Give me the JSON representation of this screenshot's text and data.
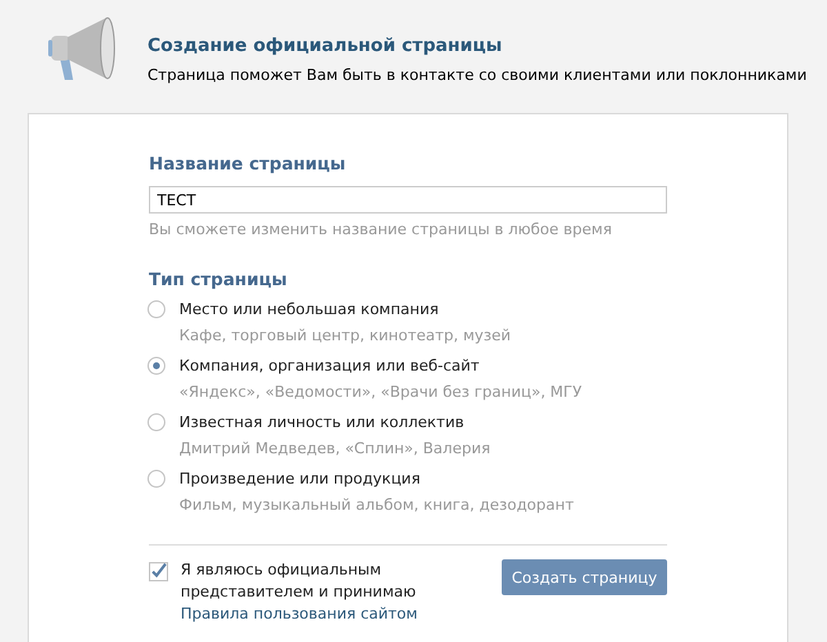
{
  "header": {
    "title": "Создание официальной страницы",
    "subtitle": "Страница поможет Вам быть в контакте со своими клиентами или поклонниками"
  },
  "name_section": {
    "heading": "Название страницы",
    "value": "ТЕСТ",
    "hint": "Вы сможете изменить название страницы в любое время"
  },
  "type_section": {
    "heading": "Тип страницы",
    "options": [
      {
        "label": "Место или небольшая компания",
        "description": "Кафе, торговый центр, кинотеатр, музей",
        "selected": false
      },
      {
        "label": "Компания, организация или веб-сайт",
        "description": "«Яндекс», «Ведомости», «Врачи без границ», МГУ",
        "selected": true
      },
      {
        "label": "Известная личность или коллектив",
        "description": "Дмитрий Медведев, «Сплин», Валерия",
        "selected": false
      },
      {
        "label": "Произведение или продукция",
        "description": "Фильм, музыкальный альбом, книга, дезодорант",
        "selected": false
      }
    ]
  },
  "agreement": {
    "checked": true,
    "text": "Я являюсь официальным представителем и принимаю",
    "link": "Правила пользования сайтом"
  },
  "submit_button": "Создать страницу"
}
